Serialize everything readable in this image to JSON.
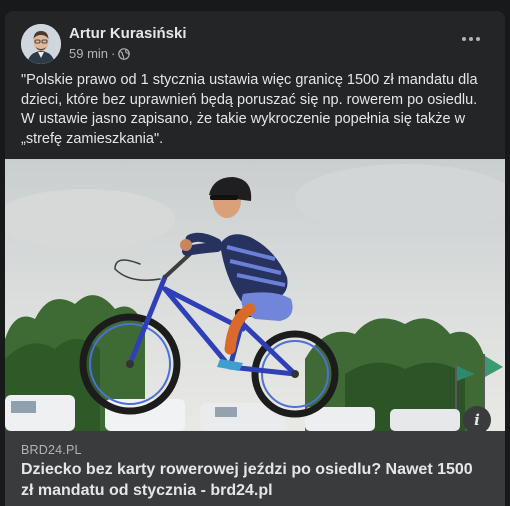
{
  "post": {
    "author": "Artur Kurasiński",
    "time": "59 min",
    "separator": "·",
    "audience_icon": "globe-icon",
    "more_icon": "more-dots-icon",
    "text": "\"Polskie prawo od 1 stycznia ustawia więc granicę 1500 zł mandatu dla dzieci, które bez uprawnień będą poruszać się np. rowerem po osiedlu. W ustawie jasno zapisano, że takie wykroczenie popełnia się także w „strefę zamieszkania\"."
  },
  "link_preview": {
    "domain": "BRD24.PL",
    "title": "Dziecko bez karty rowerowej jeździ po osiedlu? Nawet 1500 zł mandatu od stycznia - brd24.pl",
    "info_icon": "info-icon",
    "info_label": "i"
  },
  "colors": {
    "background": "#18191a",
    "card": "#242526",
    "link_box": "#3a3b3c",
    "text_primary": "#e4e6eb",
    "text_secondary": "#b0b3b8",
    "bike": "#2f3fb8"
  }
}
